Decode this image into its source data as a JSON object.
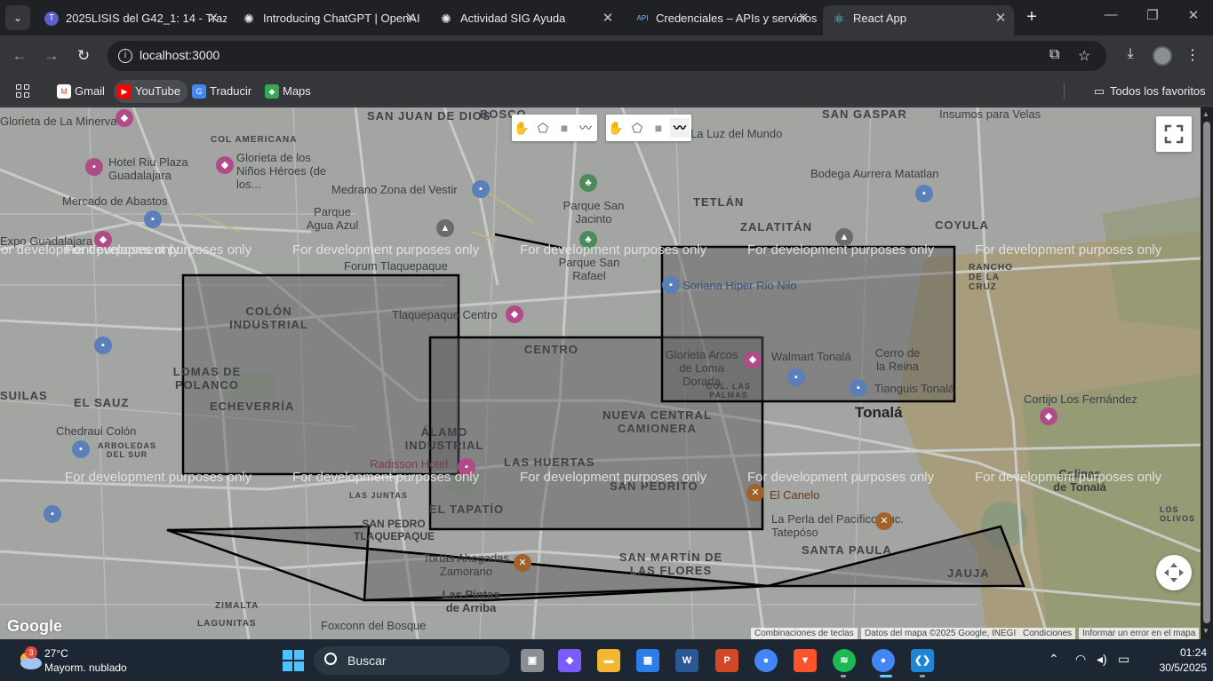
{
  "browser": {
    "tabs": [
      {
        "title": "2025LISIS del G42_1: 14 - Traz",
        "icon": "teams-icon",
        "icon_glyph": "T",
        "color": "#5b5fc7"
      },
      {
        "title": "Introducing ChatGPT | OpenAI",
        "icon": "openai-icon",
        "icon_glyph": "✺",
        "color": "#e8eaed"
      },
      {
        "title": "Actividad SIG Ayuda",
        "icon": "openai-icon",
        "icon_glyph": "✺",
        "color": "#e8eaed"
      },
      {
        "title": "Credenciales – APIs y servicios",
        "icon": "api-icon",
        "icon_glyph": "API",
        "color": "#8ab4f8"
      },
      {
        "title": "React App",
        "icon": "react-icon",
        "icon_glyph": "⚛",
        "color": "#61dafb"
      }
    ],
    "active_tab_index": 4,
    "url": "localhost:3000",
    "bookmarks": [
      {
        "label": "Gmail",
        "icon": "gmail-icon",
        "glyph": "M",
        "color": "#ea4335"
      },
      {
        "label": "YouTube",
        "icon": "youtube-icon",
        "glyph": "▶",
        "color": "#ff0000"
      },
      {
        "label": "Traducir",
        "icon": "translate-icon",
        "glyph": "G",
        "color": "#4285f4"
      },
      {
        "label": "Maps",
        "icon": "maps-icon",
        "glyph": "◆",
        "color": "#34a853"
      }
    ],
    "all_bookmarks_label": "Todos los favoritos"
  },
  "map": {
    "neighborhoods": [
      {
        "t": "SAN JUAN DE DIOS"
      },
      {
        "t": "BOSCO"
      },
      {
        "t": "SAN GASPAR"
      },
      {
        "t": "COL AMERICANA"
      },
      {
        "t": "TETLÁN"
      },
      {
        "t": "ZALATITÁN"
      },
      {
        "t": "COYULA"
      },
      {
        "t": "COLÓN INDUSTRIAL"
      },
      {
        "t": "CENTRO"
      },
      {
        "t": "LOMAS DE POLANCO"
      },
      {
        "t": "EL SAUZ"
      },
      {
        "t": "ECHEVERRÍA"
      },
      {
        "t": "NUEVA CENTRAL CAMIONERA"
      },
      {
        "t": "ÁLAMO INDUSTRIAL"
      },
      {
        "t": "LAS HUERTAS"
      },
      {
        "t": "SAN PEDRITO"
      },
      {
        "t": "EL TAPATÍO"
      },
      {
        "t": "SAN MARTÍN DE LAS FLORES"
      },
      {
        "t": "SANTA PAULA"
      },
      {
        "t": "JAUJA"
      },
      {
        "t": "ZIMALTA"
      },
      {
        "t": "LAGUNITAS"
      },
      {
        "t": "RANCHO DE LA CRUZ"
      },
      {
        "t": "COL. LAS PALMAS"
      },
      {
        "t": "LOS OLIVOS"
      },
      {
        "t": "LAS JUNTAS"
      },
      {
        "t": "ARBOLEDAS DEL SUR"
      },
      {
        "t": "SUILAS"
      },
      {
        "t": "SAN PEDRO TLAQUEPAQUE"
      }
    ],
    "places": [
      "Hotel Riu Plaza Guadalajara",
      "Glorieta de los Niños Héroes (de los...",
      "Mercado de Abastos",
      "Medrano Zona del Vestir",
      "Parque Agua Azul",
      "Parque San Jacinto",
      "Forum Tlaquepaque",
      "Parque San Rafael",
      "Soriana Hiper Rio Nilo",
      "Bodega Aurrera Matatlan",
      "Tlaquepaque Centro",
      "Glorieta Arcos de Loma Dorada",
      "Walmart Tonalá",
      "Cerro de la Reina",
      "Tianguis Tonalá",
      "Cortijo Los Fernández",
      "Chedraui Colón",
      "Radisson Hotel",
      "El Canelo",
      "La Perla del Pacífico Suc. Tatepóso",
      "Tortas Ahogadas Zamorano",
      "Foxconn del Bosque",
      "Insumos para Velas",
      "La Luz del Mundo",
      "Expo Guadalajara",
      "Glorieta de La Minerva",
      "Las Pintas de Arriba",
      "Colinas de Tonalá"
    ],
    "city_label": "Tonalá",
    "watermark": "For development purposes only",
    "drawing_tools": [
      {
        "name": "hand-tool-icon",
        "glyph": "✋"
      },
      {
        "name": "polygon-tool-icon",
        "glyph": "⬠"
      },
      {
        "name": "rectangle-tool-icon",
        "glyph": "■"
      },
      {
        "name": "polyline-tool-icon",
        "glyph": "〰"
      }
    ],
    "attribution": {
      "shortcuts": "Combinaciones de teclas",
      "data": "Datos del mapa ©2025 Google, INEGI",
      "terms": "Condiciones",
      "report": "Informar un error en el mapa"
    },
    "google_logo": "Google"
  },
  "taskbar": {
    "temperature": "27°C",
    "weather_desc": "Mayorm. nublado",
    "weather_badge": "3",
    "search_label": "Buscar",
    "time": "01:24",
    "date": "30/5/2025",
    "apps": [
      {
        "name": "task-view-icon",
        "glyph": "▣",
        "color": "#8a8f96"
      },
      {
        "name": "copilot-icon",
        "glyph": "◆",
        "color": "#7b5cff"
      },
      {
        "name": "file-explorer-icon",
        "glyph": "▬",
        "color": "#f2b632"
      },
      {
        "name": "store-icon",
        "glyph": "▦",
        "color": "#2b7de9"
      },
      {
        "name": "word-icon",
        "glyph": "W",
        "color": "#2b5797"
      },
      {
        "name": "powerpoint-icon",
        "glyph": "P",
        "color": "#d24726"
      },
      {
        "name": "chrome-icon",
        "glyph": "●",
        "color": "#4285f4"
      },
      {
        "name": "brave-icon",
        "glyph": "▼",
        "color": "#fb542b"
      },
      {
        "name": "spotify-icon",
        "glyph": "≋",
        "color": "#1db954"
      },
      {
        "name": "chrome-icon",
        "glyph": "●",
        "color": "#4285f4"
      },
      {
        "name": "vscode-icon",
        "glyph": "❮❯",
        "color": "#1f86d6"
      }
    ]
  }
}
